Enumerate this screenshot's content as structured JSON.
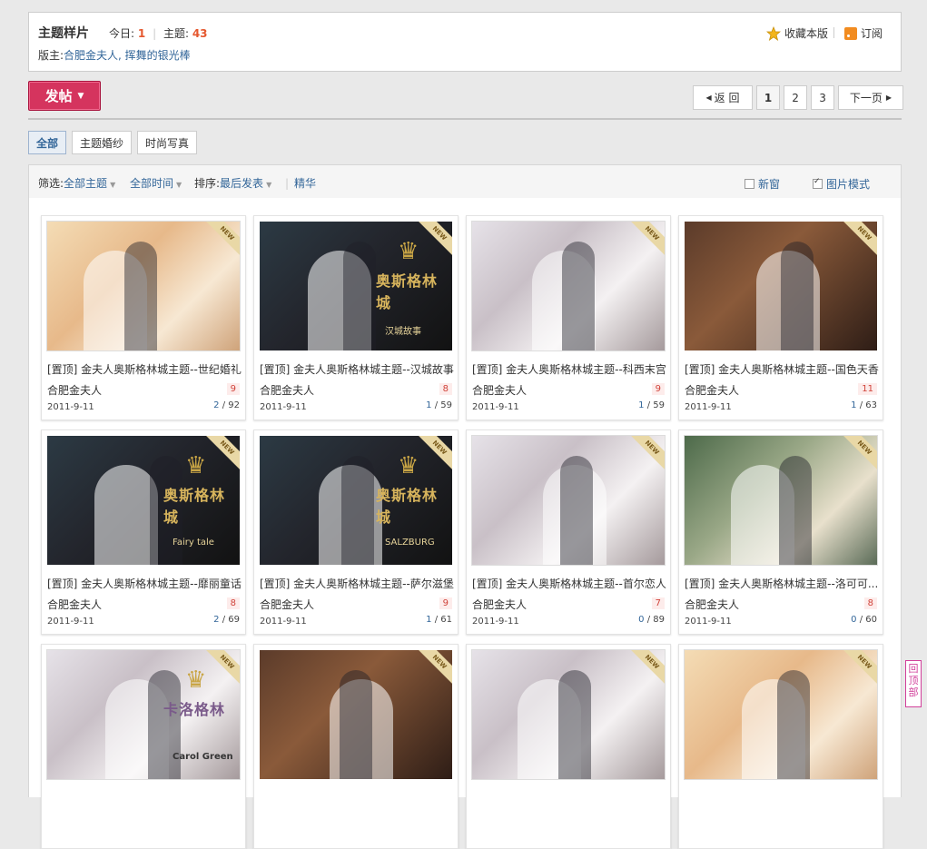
{
  "header": {
    "title": "主题样片",
    "today_label": "今日:",
    "today_value": "1",
    "topics_label": "主题:",
    "topics_value": "43",
    "moderators_label": "版主:",
    "moderators": "合肥金夫人, 挥舞的银光棒",
    "favorite": "收藏本版",
    "subscribe": "订阅"
  },
  "toolbar": {
    "post_label": "发帖",
    "back_label": "返 回",
    "pages": [
      "1",
      "2",
      "3"
    ],
    "next_label": "下一页"
  },
  "tabs": [
    "全部",
    "主题婚纱",
    "时尚写真"
  ],
  "filter": {
    "label": "筛选:",
    "all_topics": "全部主题",
    "all_time": "全部时间",
    "sort_label": "排序:",
    "sort_value": "最后发表",
    "digest": "精华",
    "new_window": "新窗",
    "image_mode": "图片模式"
  },
  "colors": {
    "accent": "#d5345e",
    "link": "#336699",
    "count": "#e5582f"
  },
  "cards": [
    {
      "title": "[置顶] 金夫人奥斯格林城主题--世纪婚礼",
      "author": "合肥金夫人",
      "replies": "9",
      "date": "2011-9-11",
      "views_a": "2",
      "views_b": "92",
      "theme": "warm"
    },
    {
      "title": "[置顶] 金夫人奥斯格林城主题--汉城故事",
      "author": "合肥金夫人",
      "replies": "8",
      "date": "2011-9-11",
      "views_a": "1",
      "views_b": "59",
      "theme": "dark",
      "brand": "奥斯格林城",
      "sub": "汉城故事"
    },
    {
      "title": "[置顶] 金夫人奥斯格林城主题--科西末宫",
      "author": "合肥金夫人",
      "replies": "9",
      "date": "2011-9-11",
      "views_a": "1",
      "views_b": "59",
      "theme": "light"
    },
    {
      "title": "[置顶] 金夫人奥斯格林城主题--国色天香",
      "author": "合肥金夫人",
      "replies": "11",
      "date": "2011-9-11",
      "views_a": "1",
      "views_b": "63",
      "theme": "brown"
    },
    {
      "title": "[置顶] 金夫人奥斯格林城主题--靡丽童话",
      "author": "合肥金夫人",
      "replies": "8",
      "date": "2011-9-11",
      "views_a": "2",
      "views_b": "69",
      "theme": "dark",
      "brand": "奥斯格林城",
      "sub": "Fairy tale"
    },
    {
      "title": "[置顶] 金夫人奥斯格林城主题--萨尔滋堡",
      "author": "合肥金夫人",
      "replies": "9",
      "date": "2011-9-11",
      "views_a": "1",
      "views_b": "61",
      "theme": "dark",
      "brand": "奥斯格林城",
      "sub": "SALZBURG"
    },
    {
      "title": "[置顶] 金夫人奥斯格林城主题--首尔恋人",
      "author": "合肥金夫人",
      "replies": "7",
      "date": "2011-9-11",
      "views_a": "0",
      "views_b": "89",
      "theme": "light"
    },
    {
      "title": "[置顶] 金夫人奥斯格林城主题--洛可可...",
      "author": "合肥金夫人",
      "replies": "8",
      "date": "2011-9-11",
      "views_a": "0",
      "views_b": "60",
      "theme": "green"
    },
    {
      "title": "",
      "author": "",
      "replies": "",
      "date": "",
      "views_a": "",
      "views_b": "",
      "theme": "light",
      "brand": "卡洛格林",
      "sub": "Carol Green"
    },
    {
      "title": "",
      "author": "",
      "replies": "",
      "date": "",
      "views_a": "",
      "views_b": "",
      "theme": "brown"
    },
    {
      "title": "",
      "author": "",
      "replies": "",
      "date": "",
      "views_a": "",
      "views_b": "",
      "theme": "light"
    },
    {
      "title": "",
      "author": "",
      "replies": "",
      "date": "",
      "views_a": "",
      "views_b": "",
      "theme": "warm"
    }
  ],
  "back_to_top": "回顶部"
}
